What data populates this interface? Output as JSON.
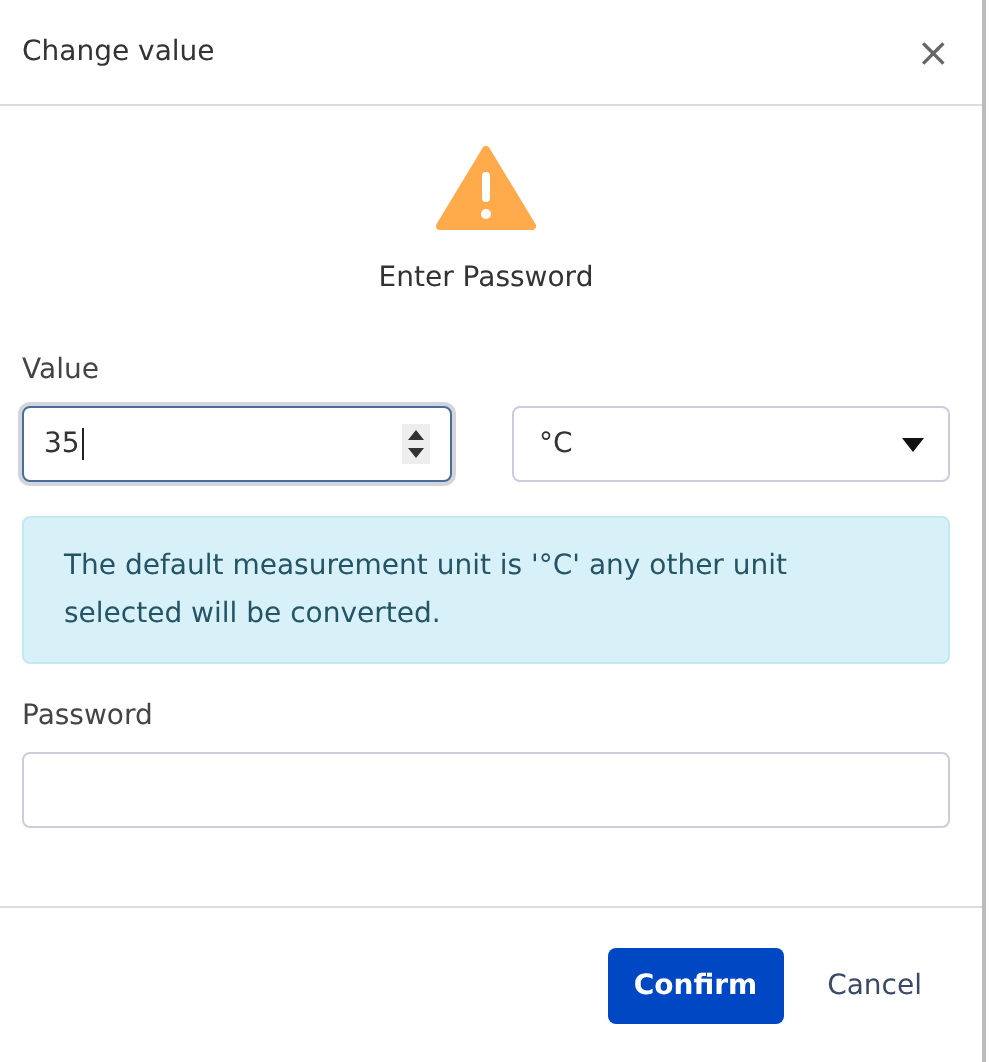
{
  "dialog": {
    "title": "Change value",
    "close": "×"
  },
  "message": "Enter Password",
  "value_field": {
    "label": "Value",
    "value": "35",
    "focused": true
  },
  "unit_select": {
    "value": "°C"
  },
  "alert": "The default measurement unit is '°C' any other unit selected will be converted.",
  "password_field": {
    "label": "Password"
  },
  "buttons": [
    {
      "label": "Confirm",
      "kind": "primary"
    },
    {
      "label": "Cancel",
      "kind": "link"
    }
  ]
}
